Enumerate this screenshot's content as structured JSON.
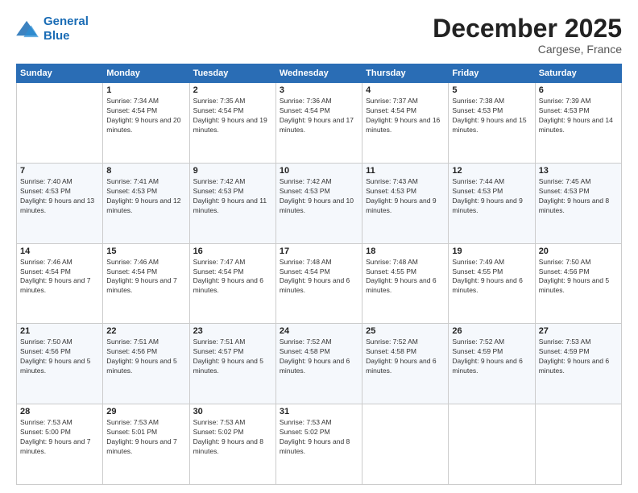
{
  "header": {
    "logo_line1": "General",
    "logo_line2": "Blue",
    "month_title": "December 2025",
    "location": "Cargese, France"
  },
  "weekdays": [
    "Sunday",
    "Monday",
    "Tuesday",
    "Wednesday",
    "Thursday",
    "Friday",
    "Saturday"
  ],
  "weeks": [
    [
      {
        "day": "",
        "sunrise": "",
        "sunset": "",
        "daylight": ""
      },
      {
        "day": "1",
        "sunrise": "Sunrise: 7:34 AM",
        "sunset": "Sunset: 4:54 PM",
        "daylight": "Daylight: 9 hours and 20 minutes."
      },
      {
        "day": "2",
        "sunrise": "Sunrise: 7:35 AM",
        "sunset": "Sunset: 4:54 PM",
        "daylight": "Daylight: 9 hours and 19 minutes."
      },
      {
        "day": "3",
        "sunrise": "Sunrise: 7:36 AM",
        "sunset": "Sunset: 4:54 PM",
        "daylight": "Daylight: 9 hours and 17 minutes."
      },
      {
        "day": "4",
        "sunrise": "Sunrise: 7:37 AM",
        "sunset": "Sunset: 4:54 PM",
        "daylight": "Daylight: 9 hours and 16 minutes."
      },
      {
        "day": "5",
        "sunrise": "Sunrise: 7:38 AM",
        "sunset": "Sunset: 4:53 PM",
        "daylight": "Daylight: 9 hours and 15 minutes."
      },
      {
        "day": "6",
        "sunrise": "Sunrise: 7:39 AM",
        "sunset": "Sunset: 4:53 PM",
        "daylight": "Daylight: 9 hours and 14 minutes."
      }
    ],
    [
      {
        "day": "7",
        "sunrise": "Sunrise: 7:40 AM",
        "sunset": "Sunset: 4:53 PM",
        "daylight": "Daylight: 9 hours and 13 minutes."
      },
      {
        "day": "8",
        "sunrise": "Sunrise: 7:41 AM",
        "sunset": "Sunset: 4:53 PM",
        "daylight": "Daylight: 9 hours and 12 minutes."
      },
      {
        "day": "9",
        "sunrise": "Sunrise: 7:42 AM",
        "sunset": "Sunset: 4:53 PM",
        "daylight": "Daylight: 9 hours and 11 minutes."
      },
      {
        "day": "10",
        "sunrise": "Sunrise: 7:42 AM",
        "sunset": "Sunset: 4:53 PM",
        "daylight": "Daylight: 9 hours and 10 minutes."
      },
      {
        "day": "11",
        "sunrise": "Sunrise: 7:43 AM",
        "sunset": "Sunset: 4:53 PM",
        "daylight": "Daylight: 9 hours and 9 minutes."
      },
      {
        "day": "12",
        "sunrise": "Sunrise: 7:44 AM",
        "sunset": "Sunset: 4:53 PM",
        "daylight": "Daylight: 9 hours and 9 minutes."
      },
      {
        "day": "13",
        "sunrise": "Sunrise: 7:45 AM",
        "sunset": "Sunset: 4:53 PM",
        "daylight": "Daylight: 9 hours and 8 minutes."
      }
    ],
    [
      {
        "day": "14",
        "sunrise": "Sunrise: 7:46 AM",
        "sunset": "Sunset: 4:54 PM",
        "daylight": "Daylight: 9 hours and 7 minutes."
      },
      {
        "day": "15",
        "sunrise": "Sunrise: 7:46 AM",
        "sunset": "Sunset: 4:54 PM",
        "daylight": "Daylight: 9 hours and 7 minutes."
      },
      {
        "day": "16",
        "sunrise": "Sunrise: 7:47 AM",
        "sunset": "Sunset: 4:54 PM",
        "daylight": "Daylight: 9 hours and 6 minutes."
      },
      {
        "day": "17",
        "sunrise": "Sunrise: 7:48 AM",
        "sunset": "Sunset: 4:54 PM",
        "daylight": "Daylight: 9 hours and 6 minutes."
      },
      {
        "day": "18",
        "sunrise": "Sunrise: 7:48 AM",
        "sunset": "Sunset: 4:55 PM",
        "daylight": "Daylight: 9 hours and 6 minutes."
      },
      {
        "day": "19",
        "sunrise": "Sunrise: 7:49 AM",
        "sunset": "Sunset: 4:55 PM",
        "daylight": "Daylight: 9 hours and 6 minutes."
      },
      {
        "day": "20",
        "sunrise": "Sunrise: 7:50 AM",
        "sunset": "Sunset: 4:56 PM",
        "daylight": "Daylight: 9 hours and 5 minutes."
      }
    ],
    [
      {
        "day": "21",
        "sunrise": "Sunrise: 7:50 AM",
        "sunset": "Sunset: 4:56 PM",
        "daylight": "Daylight: 9 hours and 5 minutes."
      },
      {
        "day": "22",
        "sunrise": "Sunrise: 7:51 AM",
        "sunset": "Sunset: 4:56 PM",
        "daylight": "Daylight: 9 hours and 5 minutes."
      },
      {
        "day": "23",
        "sunrise": "Sunrise: 7:51 AM",
        "sunset": "Sunset: 4:57 PM",
        "daylight": "Daylight: 9 hours and 5 minutes."
      },
      {
        "day": "24",
        "sunrise": "Sunrise: 7:52 AM",
        "sunset": "Sunset: 4:58 PM",
        "daylight": "Daylight: 9 hours and 6 minutes."
      },
      {
        "day": "25",
        "sunrise": "Sunrise: 7:52 AM",
        "sunset": "Sunset: 4:58 PM",
        "daylight": "Daylight: 9 hours and 6 minutes."
      },
      {
        "day": "26",
        "sunrise": "Sunrise: 7:52 AM",
        "sunset": "Sunset: 4:59 PM",
        "daylight": "Daylight: 9 hours and 6 minutes."
      },
      {
        "day": "27",
        "sunrise": "Sunrise: 7:53 AM",
        "sunset": "Sunset: 4:59 PM",
        "daylight": "Daylight: 9 hours and 6 minutes."
      }
    ],
    [
      {
        "day": "28",
        "sunrise": "Sunrise: 7:53 AM",
        "sunset": "Sunset: 5:00 PM",
        "daylight": "Daylight: 9 hours and 7 minutes."
      },
      {
        "day": "29",
        "sunrise": "Sunrise: 7:53 AM",
        "sunset": "Sunset: 5:01 PM",
        "daylight": "Daylight: 9 hours and 7 minutes."
      },
      {
        "day": "30",
        "sunrise": "Sunrise: 7:53 AM",
        "sunset": "Sunset: 5:02 PM",
        "daylight": "Daylight: 9 hours and 8 minutes."
      },
      {
        "day": "31",
        "sunrise": "Sunrise: 7:53 AM",
        "sunset": "Sunset: 5:02 PM",
        "daylight": "Daylight: 9 hours and 8 minutes."
      },
      {
        "day": "",
        "sunrise": "",
        "sunset": "",
        "daylight": ""
      },
      {
        "day": "",
        "sunrise": "",
        "sunset": "",
        "daylight": ""
      },
      {
        "day": "",
        "sunrise": "",
        "sunset": "",
        "daylight": ""
      }
    ]
  ]
}
